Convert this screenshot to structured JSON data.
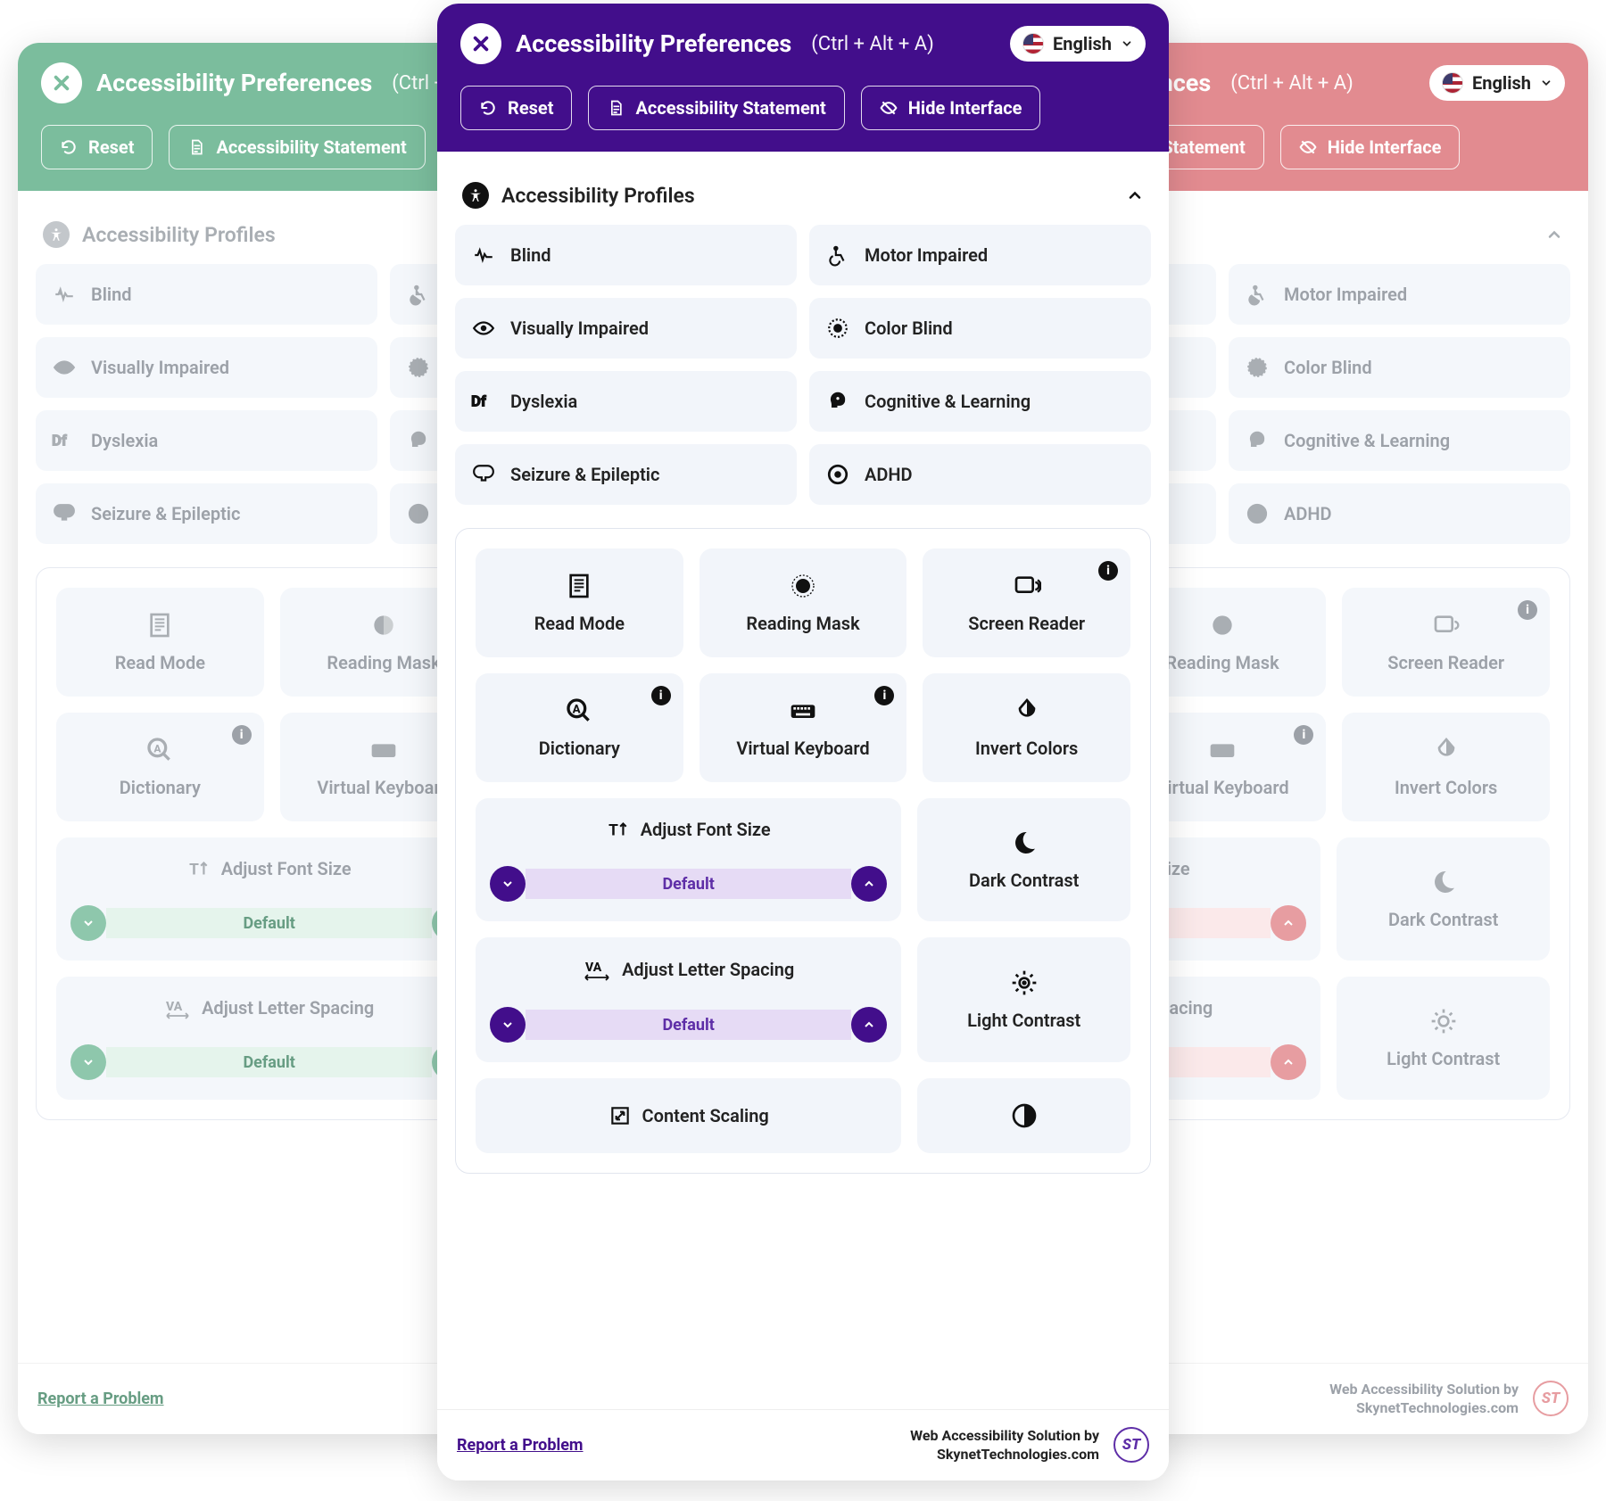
{
  "header": {
    "title": "Accessibility Preferences",
    "shortcut": "(Ctrl + Alt + A)",
    "language": "English",
    "reset": "Reset",
    "statement": "Accessibility Statement",
    "hide": "Hide Interface"
  },
  "profiles": {
    "heading": "Accessibility Profiles",
    "items": [
      {
        "label": "Blind"
      },
      {
        "label": "Motor Impaired"
      },
      {
        "label": "Visually Impaired"
      },
      {
        "label": "Color Blind"
      },
      {
        "label": "Dyslexia"
      },
      {
        "label": "Cognitive & Learning"
      },
      {
        "label": "Seizure & Epileptic"
      },
      {
        "label": "ADHD"
      }
    ]
  },
  "options": {
    "row1": [
      {
        "label": "Read Mode"
      },
      {
        "label": "Reading Mask"
      },
      {
        "label": "Screen Reader",
        "info": true
      }
    ],
    "row2": [
      {
        "label": "Dictionary",
        "info": true
      },
      {
        "label": "Virtual Keyboard",
        "info": true
      },
      {
        "label": "Invert Colors"
      }
    ],
    "adjust_font": "Adjust Font Size",
    "adjust_letter": "Adjust Letter Spacing",
    "content_scaling": "Content Scaling",
    "default": "Default",
    "dark": "Dark Contrast",
    "light": "Light Contrast"
  },
  "footer": {
    "report": "Report a Problem",
    "line1": "Web Accessibility Solution by",
    "line2": "SkynetTechnologies.com",
    "logo": "ST"
  }
}
